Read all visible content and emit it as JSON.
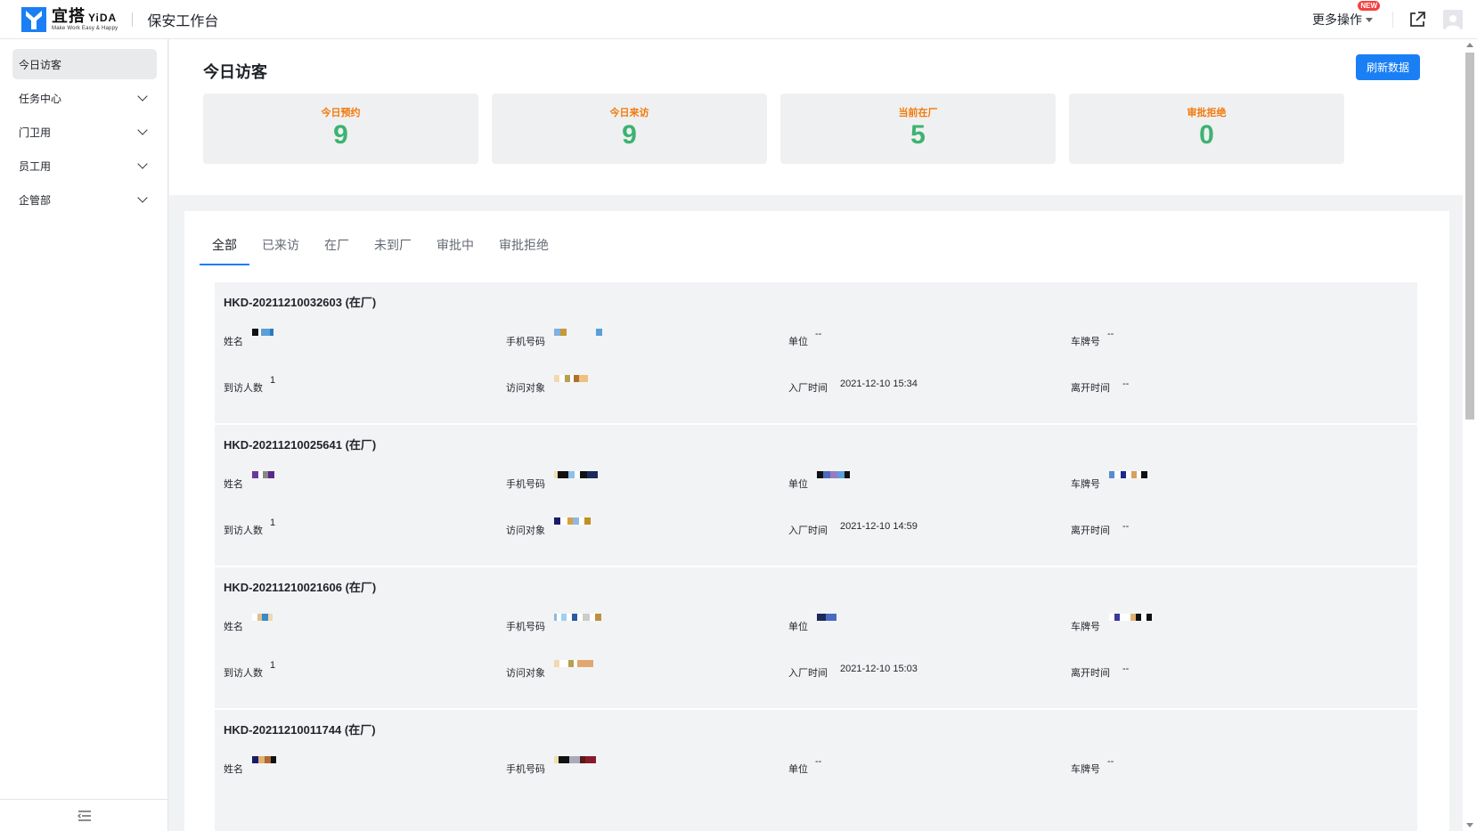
{
  "brand": {
    "name_cn": "宜搭",
    "name_en": "YiDA",
    "slogan": "Make Work Easy & Happy",
    "color": "#1a7ff5"
  },
  "app": {
    "title": "保安工作台"
  },
  "topbar": {
    "more_ops": "更多操作",
    "new_badge": "NEW",
    "icons": [
      "external-link-icon",
      "user-avatar-icon"
    ]
  },
  "sidebar": {
    "items": [
      {
        "label": "今日访客",
        "active": true
      },
      {
        "label": "任务中心",
        "expandable": true
      },
      {
        "label": "门卫用",
        "expandable": true
      },
      {
        "label": "员工用",
        "expandable": true
      },
      {
        "label": "企管部",
        "expandable": true
      }
    ],
    "footer_icon": "collapse-menu-icon"
  },
  "main": {
    "title": "今日访客",
    "refresh_label": "刷新数据",
    "stats": [
      {
        "label": "今日预约",
        "value": "9"
      },
      {
        "label": "今日来访",
        "value": "9"
      },
      {
        "label": "当前在厂",
        "value": "5"
      },
      {
        "label": "审批拒绝",
        "value": "0"
      }
    ],
    "stat_label_color": "#f2790a",
    "stat_value_color": "#3cb371",
    "tabs": [
      "全部",
      "已来访",
      "在厂",
      "未到厂",
      "审批中",
      "审批拒绝"
    ],
    "field_labels": {
      "name": "姓名",
      "phone": "手机号码",
      "company": "单位",
      "plate": "车牌号",
      "count": "到访人数",
      "visitee": "访问对象",
      "entry": "入厂时间",
      "leave": "离开时间"
    },
    "records": [
      {
        "title": "HKD-20211210032603 (在厂)",
        "company": "--",
        "plate": "--",
        "count": "1",
        "entry": "2021-12-10 15:34",
        "leave": "--"
      },
      {
        "title": "HKD-20211210025641 (在厂)",
        "count": "1",
        "entry": "2021-12-10 14:59",
        "leave": "--"
      },
      {
        "title": "HKD-20211210021606 (在厂)",
        "count": "1",
        "entry": "2021-12-10 15:03",
        "leave": "--"
      },
      {
        "title": "HKD-20211210011744 (在厂)",
        "company": "--",
        "plate": "--"
      }
    ]
  }
}
